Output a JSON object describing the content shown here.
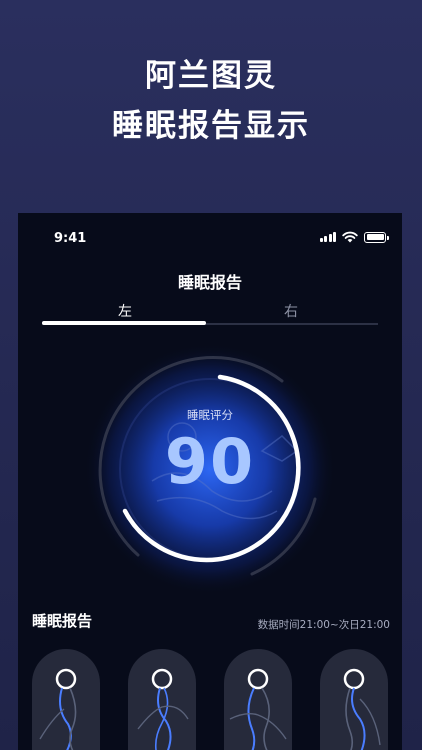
{
  "headline": {
    "line1": "阿兰图灵",
    "line2": "睡眠报告显示"
  },
  "status_bar": {
    "time": "9:41"
  },
  "page": {
    "title": "睡眠报告"
  },
  "tabs": [
    {
      "label": "左",
      "active": true
    },
    {
      "label": "右",
      "active": false
    }
  ],
  "score": {
    "label": "睡眠评分",
    "value": "90",
    "max": 100
  },
  "report": {
    "title": "睡眠报告",
    "time_range": "数据时间21:00~次日21:00"
  },
  "colors": {
    "background": "#262a55",
    "phone": "#070b1a",
    "accent_blue": "#4a7dff",
    "score_text": "#a8c7ff"
  },
  "icons": [
    "signal-icon",
    "wifi-icon",
    "battery-icon"
  ]
}
